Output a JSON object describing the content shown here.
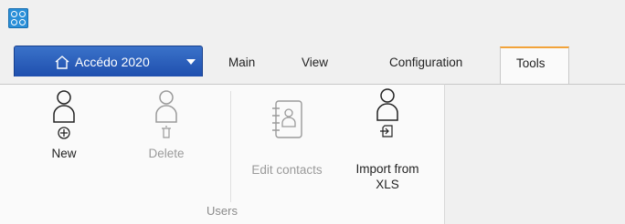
{
  "app": {
    "logo_icon": "app-logo-icon"
  },
  "ribbon_tabs": {
    "file_tab": {
      "label": "Accédo 2020",
      "icon": "home-icon"
    },
    "tabs": [
      "Main",
      "View",
      "Configuration",
      "Tools"
    ],
    "active_tab": "Tools"
  },
  "groups": {
    "users": {
      "label": "Users",
      "buttons": {
        "new": {
          "label": "New",
          "icon": "user-add-icon",
          "enabled": true
        },
        "delete": {
          "label": "Delete",
          "icon": "user-delete-icon",
          "enabled": false
        },
        "edit_contacts": {
          "label": "Edit contacts",
          "icon": "address-book-icon",
          "enabled": false
        },
        "import_xls": {
          "label_line1": "Import from",
          "label_line2": "XLS",
          "icon": "user-import-icon",
          "enabled": true
        }
      }
    }
  },
  "colors": {
    "file_tab": "#2a5fbd",
    "active_tab_accent": "#f2a33a",
    "app_logo": "#2a8fd8"
  }
}
